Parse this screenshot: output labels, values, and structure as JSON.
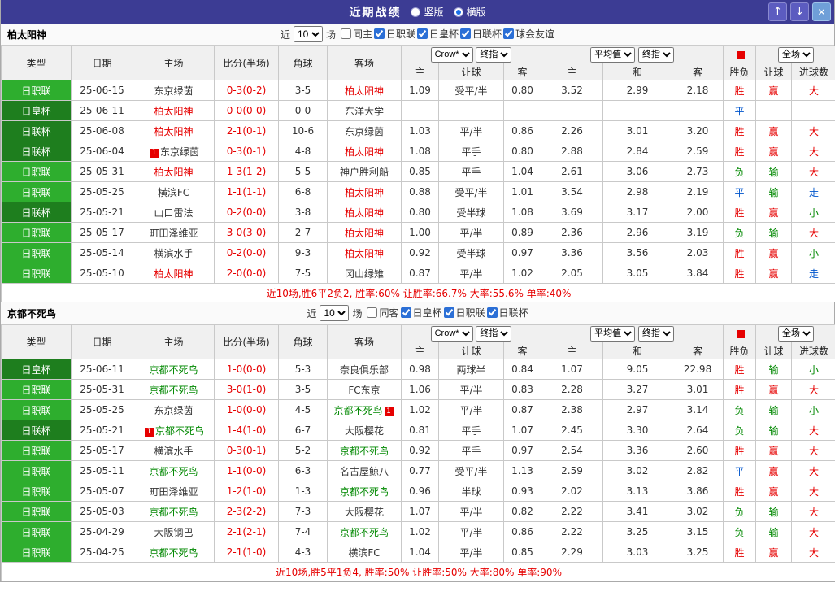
{
  "topbar": {
    "title": "近期战绩",
    "layout_options": [
      {
        "label": "竖版",
        "selected": false
      },
      {
        "label": "横版",
        "selected": true
      }
    ],
    "icons": {
      "up": "↑",
      "down": "↓",
      "close": "✕"
    }
  },
  "table": {
    "near_label": "近",
    "count": "10",
    "matches_label": "场",
    "col_headers": [
      "类型",
      "日期",
      "主场",
      "比分(半场)",
      "角球",
      "客场"
    ],
    "sub_headers": [
      "主",
      "让球",
      "客",
      "主",
      "和",
      "客",
      "胜负",
      "让球",
      "进球数"
    ],
    "dropdowns": {
      "company": "Crow*",
      "stage": "终指",
      "average": "平均值",
      "scope": "全场"
    }
  },
  "colors": {
    "league": {
      "日职联": "#2eae2e",
      "日皇杯": "#1e7e1e",
      "日联杯": "#1e7e1e"
    },
    "result": {
      "胜": "#e60000",
      "平": "#0055cc",
      "负": "#008800",
      "赢": "#e60000",
      "走": "#0055cc",
      "输": "#008800",
      "大": "#e60000",
      "小": "#008800"
    },
    "score": "#e60000",
    "badge": "#e60000"
  },
  "sections": [
    {
      "team": "柏太阳神",
      "team_color": "#e60000",
      "filters": [
        {
          "label": "同主",
          "checked": false
        },
        {
          "label": "日职联",
          "checked": true
        },
        {
          "label": "日皇杯",
          "checked": true
        },
        {
          "label": "日联杯",
          "checked": true
        },
        {
          "label": "球会友谊",
          "checked": true
        }
      ],
      "summary": "近10场,胜6平2负2, 胜率:60% 让胜率:66.7% 大率:55.6% 单率:40%",
      "rows": [
        {
          "league": "日职联",
          "date": "25-06-15",
          "home": "东京绿茵",
          "home_hl": false,
          "score": "0-3(0-2)",
          "corner": "3-5",
          "away": "柏太阳神",
          "away_hl": true,
          "odds": [
            "1.09",
            "受平/半",
            "0.80",
            "3.52",
            "2.99",
            "2.18"
          ],
          "results": [
            "胜",
            "赢",
            "大"
          ]
        },
        {
          "league": "日皇杯",
          "date": "25-06-11",
          "home": "柏太阳神",
          "home_hl": true,
          "score": "0-0(0-0)",
          "corner": "0-0",
          "away": "东洋大学",
          "away_hl": false,
          "odds": [
            "",
            "",
            "",
            "",
            "",
            ""
          ],
          "results": [
            "平",
            "",
            ""
          ]
        },
        {
          "league": "日联杯",
          "date": "25-06-08",
          "home": "柏太阳神",
          "home_hl": true,
          "score": "2-1(0-1)",
          "corner": "10-6",
          "away": "东京绿茵",
          "away_hl": false,
          "odds": [
            "1.03",
            "平/半",
            "0.86",
            "2.26",
            "3.01",
            "3.20"
          ],
          "results": [
            "胜",
            "赢",
            "大"
          ]
        },
        {
          "league": "日联杯",
          "date": "25-06-04",
          "home": "东京绿茵",
          "home_hl": false,
          "home_badge": "1",
          "home_badge_side": "left",
          "score": "0-3(0-1)",
          "corner": "4-8",
          "away": "柏太阳神",
          "away_hl": true,
          "odds": [
            "1.08",
            "平手",
            "0.80",
            "2.88",
            "2.84",
            "2.59"
          ],
          "results": [
            "胜",
            "赢",
            "大"
          ]
        },
        {
          "league": "日职联",
          "date": "25-05-31",
          "home": "柏太阳神",
          "home_hl": true,
          "score": "1-3(1-2)",
          "corner": "5-5",
          "away": "神户胜利船",
          "away_hl": false,
          "odds": [
            "0.85",
            "平手",
            "1.04",
            "2.61",
            "3.06",
            "2.73"
          ],
          "results": [
            "负",
            "输",
            "大"
          ]
        },
        {
          "league": "日职联",
          "date": "25-05-25",
          "home": "横滨FC",
          "home_hl": false,
          "score": "1-1(1-1)",
          "corner": "6-8",
          "away": "柏太阳神",
          "away_hl": true,
          "odds": [
            "0.88",
            "受平/半",
            "1.01",
            "3.54",
            "2.98",
            "2.19"
          ],
          "results": [
            "平",
            "输",
            "走"
          ]
        },
        {
          "league": "日联杯",
          "date": "25-05-21",
          "home": "山口雷法",
          "home_hl": false,
          "score": "0-2(0-0)",
          "corner": "3-8",
          "away": "柏太阳神",
          "away_hl": true,
          "odds": [
            "0.80",
            "受半球",
            "1.08",
            "3.69",
            "3.17",
            "2.00"
          ],
          "results": [
            "胜",
            "赢",
            "小"
          ]
        },
        {
          "league": "日职联",
          "date": "25-05-17",
          "home": "町田泽维亚",
          "home_hl": false,
          "score": "3-0(3-0)",
          "corner": "2-7",
          "away": "柏太阳神",
          "away_hl": true,
          "odds": [
            "1.00",
            "平/半",
            "0.89",
            "2.36",
            "2.96",
            "3.19"
          ],
          "results": [
            "负",
            "输",
            "大"
          ]
        },
        {
          "league": "日职联",
          "date": "25-05-14",
          "home": "横滨水手",
          "home_hl": false,
          "score": "0-2(0-0)",
          "corner": "9-3",
          "away": "柏太阳神",
          "away_hl": true,
          "odds": [
            "0.92",
            "受半球",
            "0.97",
            "3.36",
            "3.56",
            "2.03"
          ],
          "results": [
            "胜",
            "赢",
            "小"
          ]
        },
        {
          "league": "日职联",
          "date": "25-05-10",
          "home": "柏太阳神",
          "home_hl": true,
          "score": "2-0(0-0)",
          "corner": "7-5",
          "away": "冈山绿雉",
          "away_hl": false,
          "odds": [
            "0.87",
            "平/半",
            "1.02",
            "2.05",
            "3.05",
            "3.84"
          ],
          "results": [
            "胜",
            "赢",
            "走"
          ]
        }
      ]
    },
    {
      "team": "京都不死鸟",
      "team_color": "#008800",
      "filters": [
        {
          "label": "同客",
          "checked": false
        },
        {
          "label": "日皇杯",
          "checked": true
        },
        {
          "label": "日职联",
          "checked": true
        },
        {
          "label": "日联杯",
          "checked": true
        }
      ],
      "summary": "近10场,胜5平1负4, 胜率:50% 让胜率:50% 大率:80% 单率:90%",
      "rows": [
        {
          "league": "日皇杯",
          "date": "25-06-11",
          "home": "京都不死鸟",
          "home_hl": true,
          "score": "1-0(0-0)",
          "corner": "5-3",
          "away": "奈良俱乐部",
          "away_hl": false,
          "odds": [
            "0.98",
            "两球半",
            "0.84",
            "1.07",
            "9.05",
            "22.98"
          ],
          "results": [
            "胜",
            "输",
            "小"
          ]
        },
        {
          "league": "日职联",
          "date": "25-05-31",
          "home": "京都不死鸟",
          "home_hl": true,
          "score": "3-0(1-0)",
          "corner": "3-5",
          "away": "FC东京",
          "away_hl": false,
          "odds": [
            "1.06",
            "平/半",
            "0.83",
            "2.28",
            "3.27",
            "3.01"
          ],
          "results": [
            "胜",
            "赢",
            "大"
          ]
        },
        {
          "league": "日职联",
          "date": "25-05-25",
          "home": "东京绿茵",
          "home_hl": false,
          "score": "1-0(0-0)",
          "corner": "4-5",
          "away": "京都不死鸟",
          "away_hl": true,
          "away_badge": "1",
          "away_badge_side": "right",
          "odds": [
            "1.02",
            "平/半",
            "0.87",
            "2.38",
            "2.97",
            "3.14"
          ],
          "results": [
            "负",
            "输",
            "小"
          ]
        },
        {
          "league": "日联杯",
          "date": "25-05-21",
          "home": "京都不死鸟",
          "home_hl": true,
          "home_badge": "1",
          "home_badge_side": "left",
          "score": "1-4(1-0)",
          "corner": "6-7",
          "away": "大阪樱花",
          "away_hl": false,
          "odds": [
            "0.81",
            "平手",
            "1.07",
            "2.45",
            "3.30",
            "2.64"
          ],
          "results": [
            "负",
            "输",
            "大"
          ]
        },
        {
          "league": "日职联",
          "date": "25-05-17",
          "home": "横滨水手",
          "home_hl": false,
          "score": "0-3(0-1)",
          "corner": "5-2",
          "away": "京都不死鸟",
          "away_hl": true,
          "odds": [
            "0.92",
            "平手",
            "0.97",
            "2.54",
            "3.36",
            "2.60"
          ],
          "results": [
            "胜",
            "赢",
            "大"
          ]
        },
        {
          "league": "日职联",
          "date": "25-05-11",
          "home": "京都不死鸟",
          "home_hl": true,
          "score": "1-1(0-0)",
          "corner": "6-3",
          "away": "名古屋鲸八",
          "away_hl": false,
          "odds": [
            "0.77",
            "受平/半",
            "1.13",
            "2.59",
            "3.02",
            "2.82"
          ],
          "results": [
            "平",
            "赢",
            "大"
          ]
        },
        {
          "league": "日职联",
          "date": "25-05-07",
          "home": "町田泽维亚",
          "home_hl": false,
          "score": "1-2(1-0)",
          "corner": "1-3",
          "away": "京都不死鸟",
          "away_hl": true,
          "odds": [
            "0.96",
            "半球",
            "0.93",
            "2.02",
            "3.13",
            "3.86"
          ],
          "results": [
            "胜",
            "赢",
            "大"
          ]
        },
        {
          "league": "日职联",
          "date": "25-05-03",
          "home": "京都不死鸟",
          "home_hl": true,
          "score": "2-3(2-2)",
          "corner": "7-3",
          "away": "大阪樱花",
          "away_hl": false,
          "odds": [
            "1.07",
            "平/半",
            "0.82",
            "2.22",
            "3.41",
            "3.02"
          ],
          "results": [
            "负",
            "输",
            "大"
          ]
        },
        {
          "league": "日职联",
          "date": "25-04-29",
          "home": "大阪钢巴",
          "home_hl": false,
          "score": "2-1(2-1)",
          "corner": "7-4",
          "away": "京都不死鸟",
          "away_hl": true,
          "odds": [
            "1.02",
            "平/半",
            "0.86",
            "2.22",
            "3.25",
            "3.15"
          ],
          "results": [
            "负",
            "输",
            "大"
          ]
        },
        {
          "league": "日职联",
          "date": "25-04-25",
          "home": "京都不死鸟",
          "home_hl": true,
          "score": "2-1(1-0)",
          "corner": "4-3",
          "away": "横滨FC",
          "away_hl": false,
          "odds": [
            "1.04",
            "平/半",
            "0.85",
            "2.29",
            "3.03",
            "3.25"
          ],
          "results": [
            "胜",
            "赢",
            "大"
          ]
        }
      ]
    }
  ]
}
